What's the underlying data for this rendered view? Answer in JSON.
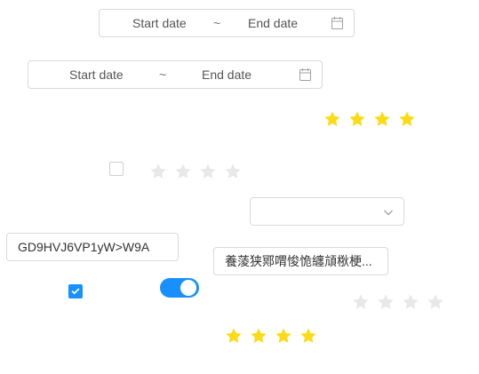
{
  "date_range_1": {
    "start_placeholder": "Start date",
    "separator": "~",
    "end_placeholder": "End date",
    "icon": "calendar-icon"
  },
  "date_range_2": {
    "start_placeholder": "Start date",
    "separator": "~",
    "end_placeholder": "End date",
    "icon": "calendar-icon"
  },
  "rating_top": {
    "value": 4,
    "max": 4,
    "color": "#fadb14"
  },
  "checkbox_1": {
    "checked": false
  },
  "rating_mid": {
    "value": 0,
    "max": 4,
    "empty_color": "#e8e8e8"
  },
  "select_1": {
    "value": "",
    "icon": "chevron-down-icon"
  },
  "text_input_1": {
    "value": "GD9HVJ6VP1yW>W9A"
  },
  "text_input_2": {
    "value": "養蔆狭鄍喟悛恑纏頏梑梗..."
  },
  "checkbox_2": {
    "checked": true,
    "color": "#1890ff"
  },
  "toggle_1": {
    "on": true,
    "color": "#1890ff"
  },
  "rating_right": {
    "value": 0,
    "max": 4,
    "empty_color": "#e8e8e8"
  },
  "rating_bottom": {
    "value": 4,
    "max": 4,
    "color": "#fadb14"
  }
}
